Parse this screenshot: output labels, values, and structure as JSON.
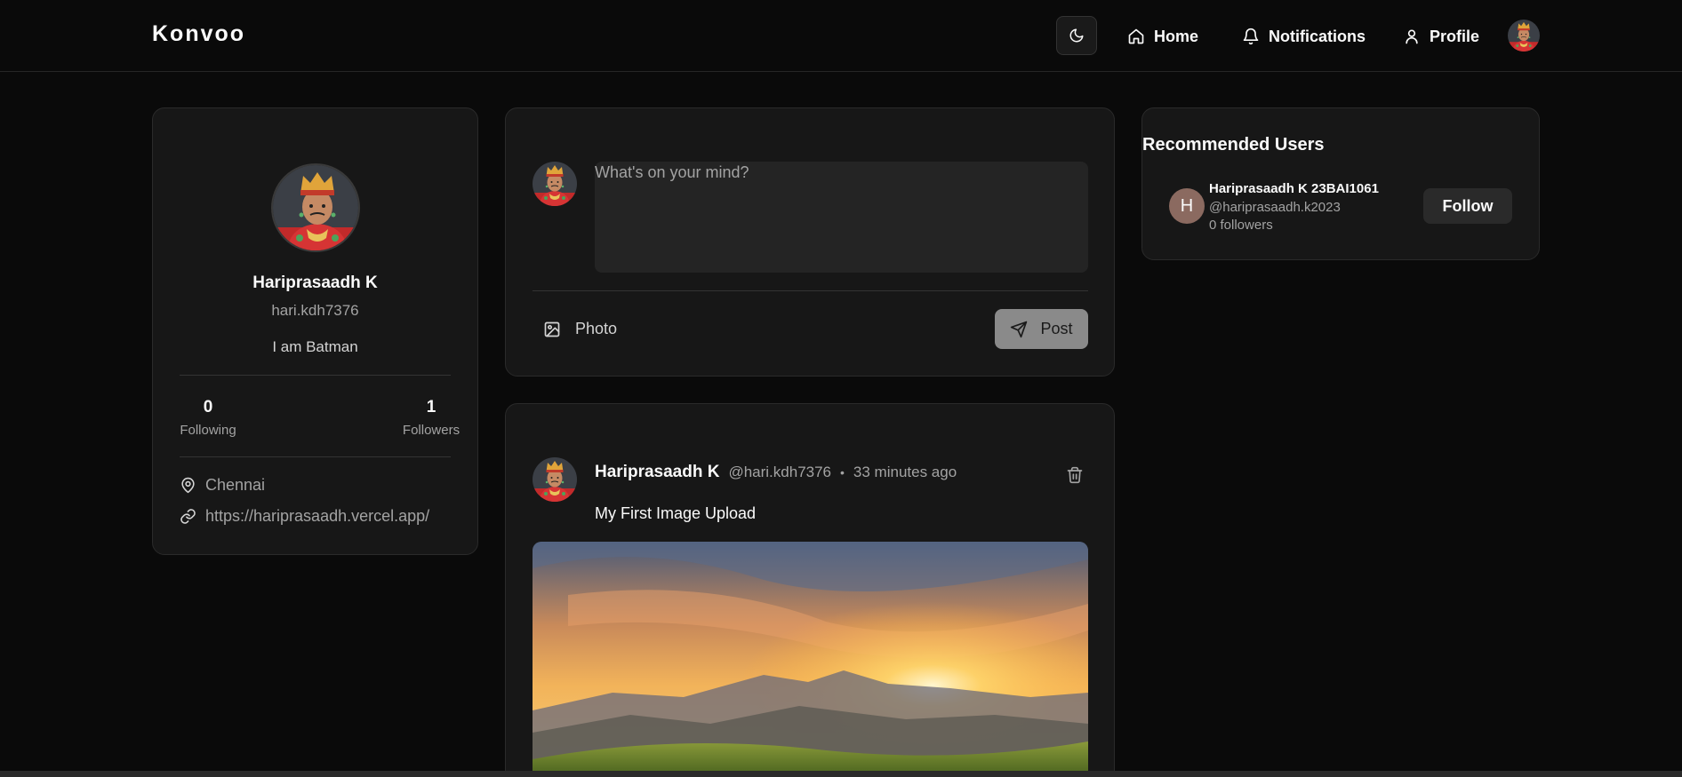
{
  "nav": {
    "brand": "Konvoo",
    "home_label": "Home",
    "notifications_label": "Notifications",
    "profile_label": "Profile"
  },
  "profile": {
    "name": "Hariprasaadh K",
    "handle": "hari.kdh7376",
    "bio": "I am Batman",
    "following_count": "0",
    "following_label": "Following",
    "followers_count": "1",
    "followers_label": "Followers",
    "location": "Chennai",
    "website": "https://hariprasaadh.vercel.app/"
  },
  "composer": {
    "placeholder": "What's on your mind?",
    "photo_label": "Photo",
    "post_label": "Post"
  },
  "post": {
    "author_name": "Hariprasaadh K",
    "author_handle": "@hari.kdh7376",
    "separator": "•",
    "time": "33 minutes ago",
    "text": "My First Image Upload"
  },
  "recommended": {
    "title": "Recommended Users",
    "users": [
      {
        "initial": "H",
        "name": "Hariprasaadh K 23BAI1061",
        "handle": "@hariprasaadh.k2023",
        "followers": "0 followers",
        "follow_label": "Follow"
      }
    ]
  },
  "icons": {
    "theme": "moon-icon",
    "home": "home-icon",
    "notifications": "bell-icon",
    "profile": "user-icon",
    "location": "map-pin-icon",
    "website": "link-icon",
    "photo": "image-icon",
    "post": "send-icon",
    "delete": "trash-icon"
  },
  "colors": {
    "background": "#0a0a0a",
    "card": "#171717",
    "text": "#fafafa",
    "muted": "#a3a3a3",
    "post_button": "#8a8a8a",
    "rec_avatar": "#8b6a60"
  }
}
